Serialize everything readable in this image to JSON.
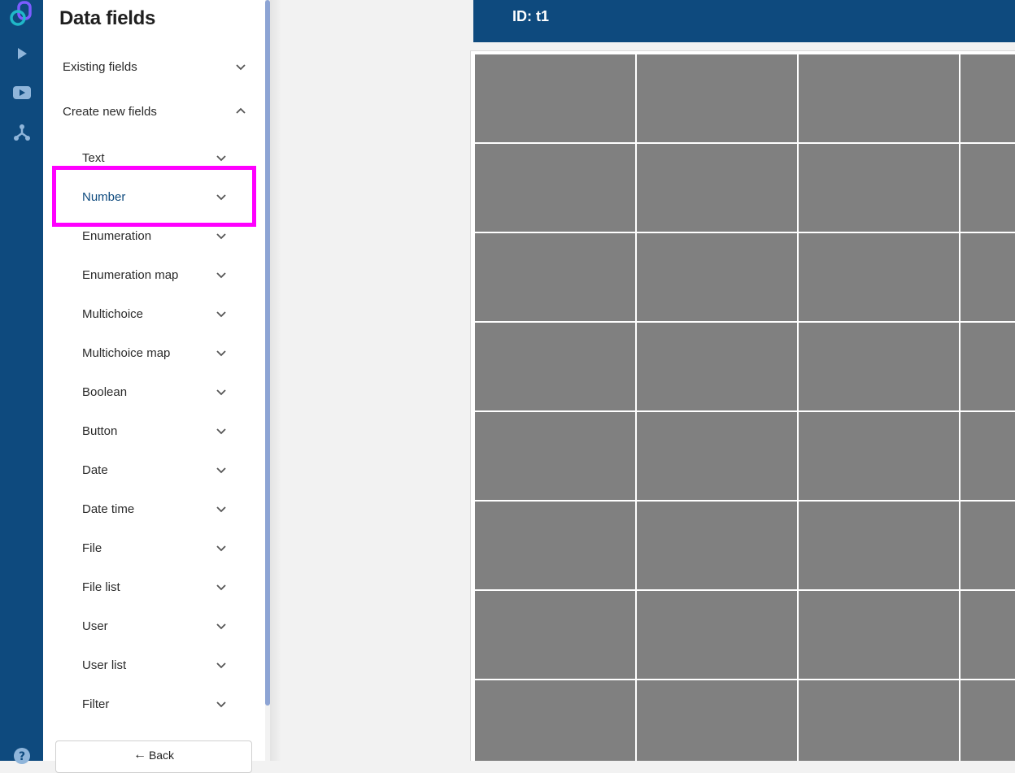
{
  "rail": {
    "icons": [
      "logo-icon",
      "play-icon",
      "video-icon",
      "tree-icon",
      "help-icon"
    ]
  },
  "panel": {
    "title": "Data fields",
    "sections": [
      {
        "label": "Existing fields",
        "expanded": false
      },
      {
        "label": "Create new fields",
        "expanded": true
      }
    ],
    "items": [
      {
        "label": "Text"
      },
      {
        "label": "Number"
      },
      {
        "label": "Enumeration"
      },
      {
        "label": "Enumeration map"
      },
      {
        "label": "Multichoice"
      },
      {
        "label": "Multichoice map"
      },
      {
        "label": "Boolean"
      },
      {
        "label": "Button"
      },
      {
        "label": "Date"
      },
      {
        "label": "Date time"
      },
      {
        "label": "File"
      },
      {
        "label": "File list"
      },
      {
        "label": "User"
      },
      {
        "label": "User list"
      },
      {
        "label": "Filter"
      }
    ],
    "selected_item": "Number",
    "back_label": "Back"
  },
  "main": {
    "header_title": "ID: t1"
  },
  "colors": {
    "rail": "#0e4a7e",
    "header": "#0e4a7e",
    "highlight": "#ff00ff",
    "cell": "#808080"
  }
}
